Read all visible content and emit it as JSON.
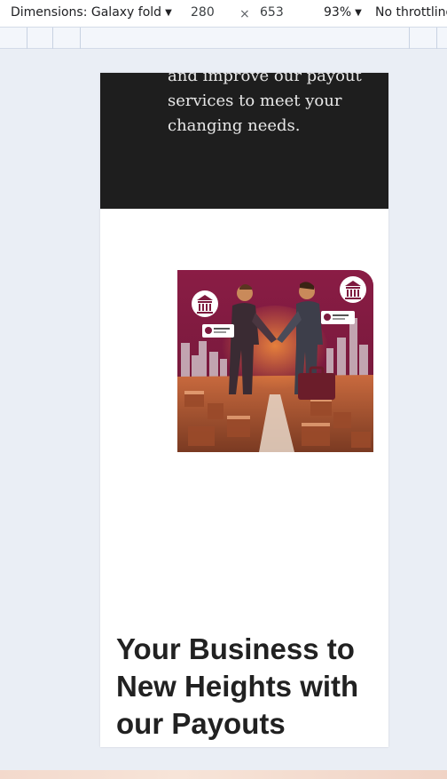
{
  "devtools": {
    "device_label": "Dimensions: Galaxy fold",
    "width": "280",
    "height": "653",
    "times": "×",
    "zoom": "93%",
    "throttle": "No throttling"
  },
  "page": {
    "intro_text": "and improve our payout services to meet your changing needs.",
    "headline": "Your Business to New Heights with our Payouts"
  },
  "colors": {
    "hero_bg": "#7d1a3e",
    "dark_section": "#1e1e1e"
  },
  "icons": [
    "chevron-down-icon",
    "bank-icon"
  ]
}
